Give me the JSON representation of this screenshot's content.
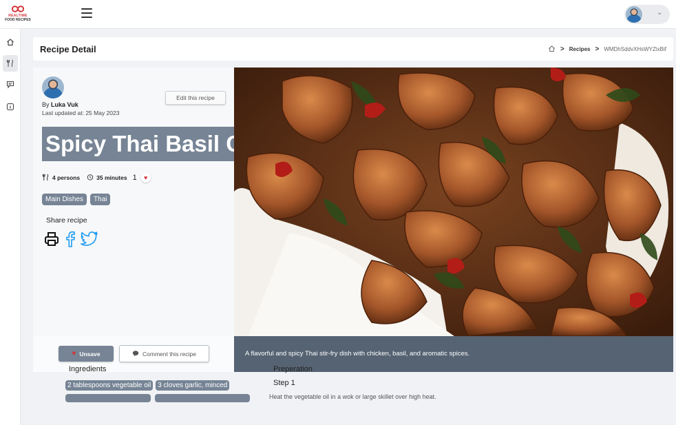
{
  "brand": {
    "line1": "REALTIME",
    "line2": "FOOD RECIPES"
  },
  "header": {
    "page_title": "Recipe Detail"
  },
  "breadcrumb": {
    "section": "Recipes",
    "current": "WMDhSddvXHsWYZixBif"
  },
  "recipe": {
    "by_label": "By",
    "author": "Luka Vuk",
    "updated": "Last updated at: 25 May 2023",
    "edit_label": "Edit this recipe",
    "title": "Spicy Thai Basil Chicken",
    "servings": "4 persons",
    "time": "35 minutes",
    "likes": "1",
    "tags": [
      "Main Dishes",
      "Thai"
    ],
    "share_label": "Share recipe",
    "description": "A flavorful and spicy Thai stir-fry dish with chicken, basil, and aromatic spices.",
    "unsave_label": "Unsave",
    "comment_label": "Comment this recipe"
  },
  "ingredients": {
    "title": "Ingredients",
    "items": [
      "2 tablespoons vegetable oil",
      "3 cloves garlic, minced"
    ]
  },
  "preparation": {
    "title": "Preperation",
    "step_label": "Step 1",
    "step_text": "Heat the vegetable oil in a wok or large skillet over high heat."
  },
  "colors": {
    "accent": "#768495",
    "caption_bg": "#566373",
    "heart": "#d3343b",
    "social": "#1d9bf0"
  }
}
